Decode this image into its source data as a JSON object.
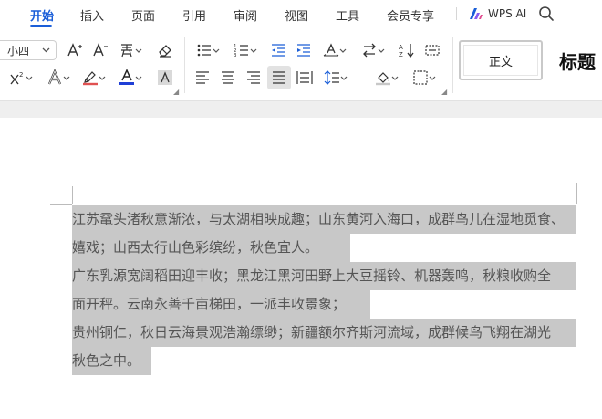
{
  "menu": {
    "tabs": [
      "开始",
      "插入",
      "页面",
      "引用",
      "审阅",
      "视图",
      "工具",
      "会员专享"
    ],
    "active_tab": "开始",
    "wps_ai_label": "WPS AI"
  },
  "toolbar": {
    "font_size": "小四",
    "styles": {
      "normal": "正文",
      "heading": "标题"
    }
  },
  "document": {
    "lines": [
      "江苏鼋头渚秋意渐浓，与太湖相映成趣；山东黄河入海口，成群鸟儿在湿地觅食、",
      "嬉戏；山西太行山色彩缤纷，秋色宜人。",
      "广东乳源宽阔稻田迎丰收；黑龙江黑河田野上大豆摇铃、机器轰鸣，秋粮收购全",
      "面开秤。云南永善千亩梯田，一派丰收景象；",
      "贵州铜仁，秋日云海景观浩瀚缥缈；新疆额尔齐斯河流域，成群候鸟飞翔在湖光",
      "秋色之中。"
    ]
  },
  "colors": {
    "accent": "#1a5ed8",
    "selection": "#c8c8c8",
    "font_color_bar": "#1f3fd6",
    "highlight_bar": "#e05252"
  }
}
